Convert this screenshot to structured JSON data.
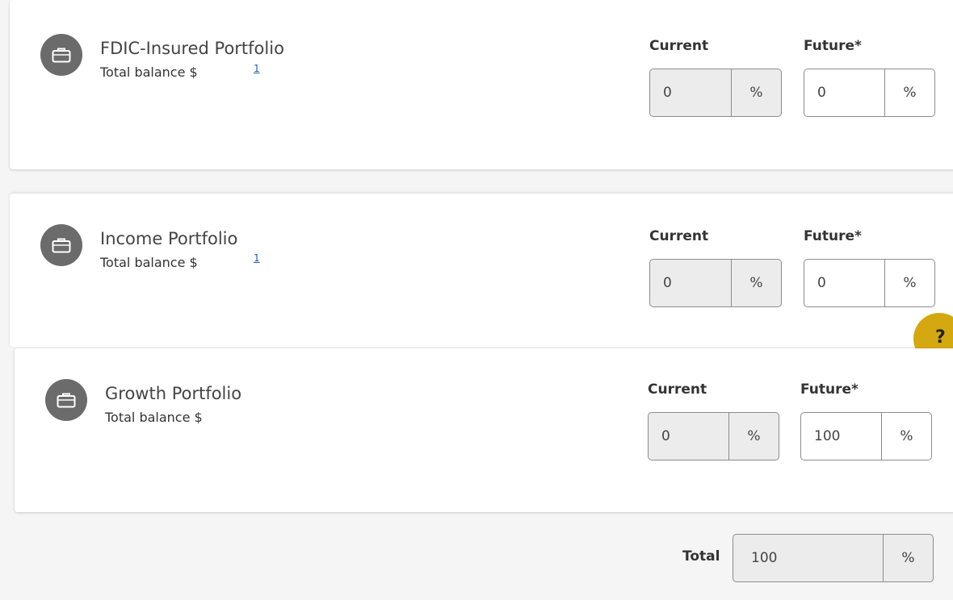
{
  "portfolios": [
    {
      "title": "FDIC-Insured Portfolio",
      "subtitle": "Total balance $",
      "footnote": "1",
      "current_label": "Current",
      "future_label": "Future*",
      "current_value": "0",
      "future_value": "0",
      "unit": "%"
    },
    {
      "title": "Income Portfolio",
      "subtitle": "Total balance $",
      "footnote": "1",
      "current_label": "Current",
      "future_label": "Future*",
      "current_value": "0",
      "future_value": "0",
      "unit": "%"
    },
    {
      "title": "Growth Portfolio",
      "subtitle": "Total balance $",
      "current_label": "Current",
      "future_label": "Future*",
      "current_value": "0",
      "future_value": "100",
      "unit": "%"
    }
  ],
  "total": {
    "label": "Total",
    "value": "100",
    "unit": "%"
  },
  "help": {
    "label": "?"
  },
  "icons": {
    "portfolio": "briefcase-icon"
  },
  "colors": {
    "icon_bg": "#6b6b6b",
    "help_bg": "#d4a811",
    "link": "#1a5fa8",
    "readonly_bg": "#ececec"
  }
}
